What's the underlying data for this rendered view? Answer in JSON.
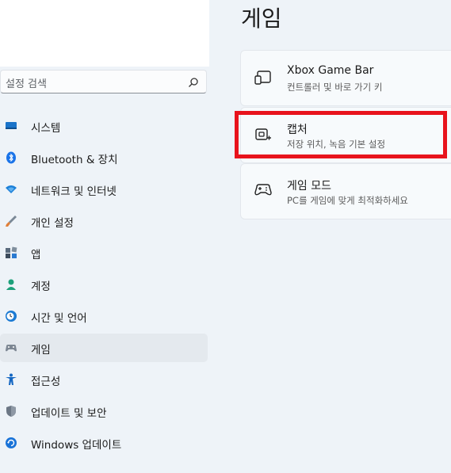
{
  "search": {
    "placeholder": "설정 검색",
    "icon": "search-icon"
  },
  "nav": {
    "items": [
      {
        "label": "시스템",
        "icon": "monitor-icon",
        "color": "#1a73c9"
      },
      {
        "label": "Bluetooth & 장치",
        "icon": "bluetooth-icon",
        "color": "#1a73e8"
      },
      {
        "label": "네트워크 및 인터넷",
        "icon": "wifi-icon",
        "color": "#1a7fd8"
      },
      {
        "label": "개인 설정",
        "icon": "brush-icon",
        "color": "#e0803a"
      },
      {
        "label": "앱",
        "icon": "apps-icon",
        "color": "#5a6b7d"
      },
      {
        "label": "계정",
        "icon": "person-icon",
        "color": "#1da07a"
      },
      {
        "label": "시간 및 언어",
        "icon": "globe-clock-icon",
        "color": "#1b7ad3"
      },
      {
        "label": "게임",
        "icon": "gamepad-icon",
        "color": "#7d8793",
        "active": true
      },
      {
        "label": "접근성",
        "icon": "accessibility-icon",
        "color": "#1567c2"
      },
      {
        "label": "업데이트 및 보안",
        "icon": "shield-icon",
        "color": "#6c7785"
      },
      {
        "label": "Windows 업데이트",
        "icon": "windows-update-icon",
        "color": "#1a73d8"
      }
    ]
  },
  "main": {
    "title": "게임",
    "cards": [
      {
        "title": "Xbox Game Bar",
        "subtitle": "컨트롤러 및 바로 가기 키",
        "icon": "game-bar-icon"
      },
      {
        "title": "캡처",
        "subtitle": "저장 위치, 녹음 기본 설정",
        "icon": "capture-icon",
        "highlighted": true
      },
      {
        "title": "게임 모드",
        "subtitle": "PC를 게임에 맞게 최적화하세요",
        "icon": "game-mode-icon"
      }
    ],
    "highlight_color": "#e8131c"
  }
}
